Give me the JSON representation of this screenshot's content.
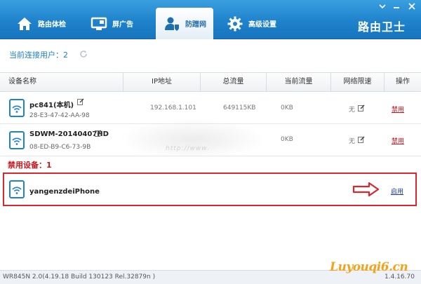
{
  "nav": {
    "items": [
      {
        "label": "路由体检",
        "icon": "house-icon"
      },
      {
        "label": "屏广告",
        "icon": "monitor-icon"
      },
      {
        "label": "防蹭网",
        "icon": "user-shield-icon"
      },
      {
        "label": "高级设置",
        "icon": "gear-icon"
      }
    ],
    "active": "防蹭网",
    "brand": "路由卫士"
  },
  "window_controls": [
    "menu-icon",
    "minimize-icon",
    "close-icon"
  ],
  "connected": {
    "label": "当前连接用户：",
    "count": "2"
  },
  "table": {
    "headers": [
      "设备名称",
      "IP地址",
      "总流量",
      "当前流量",
      "网络限速",
      "操作"
    ],
    "rows": [
      {
        "name": "pc841(本机)",
        "mac": "28-E3-47-42-AA-98",
        "ip": "192.168.1.101",
        "total": "649115KB",
        "current": "0KB",
        "limit": "无",
        "action": "禁用"
      },
      {
        "name": "SDWM-20140407HD",
        "mac": "08-ED-B9-C6-73-9B",
        "ip": "",
        "total": "",
        "current": "0KB",
        "limit": "无",
        "action": "禁用"
      }
    ]
  },
  "banned": {
    "label": "禁用设备：",
    "count": "1",
    "device": "yangenzdeiPhone",
    "action": "启用"
  },
  "footer": {
    "version": "WR845N 2.0(4.19.18 Build 130123 Rel.32879n )",
    "version_right": "1.4.16.70",
    "watermark": "Luyouqi6.cn",
    "blurred_url": "http://www."
  },
  "colors": {
    "primary": "#1f83cc",
    "danger": "#c8161e",
    "link": "#1f3fa8",
    "watermark": "#f3a21a"
  }
}
